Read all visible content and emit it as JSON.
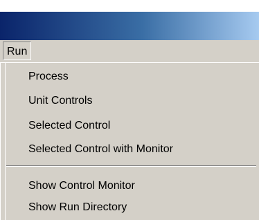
{
  "menubar": {
    "run_label": "Run"
  },
  "run_menu": {
    "items": [
      {
        "label": "Process"
      },
      {
        "label": "Unit Controls"
      },
      {
        "label": "Selected Control"
      },
      {
        "label": "Selected Control with Monitor"
      },
      {
        "label": "Show Control Monitor"
      },
      {
        "label": "Show Run Directory"
      }
    ]
  },
  "colors": {
    "menu_background": "#d4d0c8",
    "titlebar_start": "#0a246a",
    "titlebar_end": "#a6caf0"
  }
}
